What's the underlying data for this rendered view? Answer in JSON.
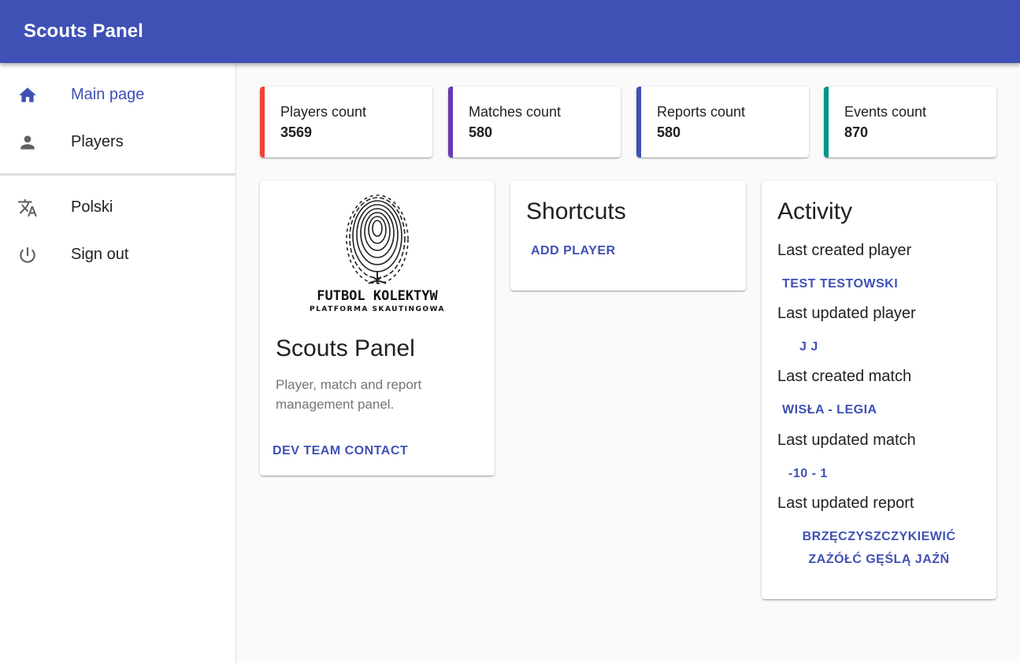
{
  "app": {
    "title": "Scouts Panel"
  },
  "nav": {
    "items": [
      {
        "label": "Main page",
        "icon": "home-icon"
      },
      {
        "label": "Players",
        "icon": "person-icon"
      }
    ],
    "secondary": [
      {
        "label": "Polski",
        "icon": "translate-icon"
      },
      {
        "label": "Sign out",
        "icon": "power-icon"
      }
    ]
  },
  "stats": [
    {
      "label": "Players count",
      "value": "3569",
      "color": "#f44336"
    },
    {
      "label": "Matches count",
      "value": "580",
      "color": "#673ab7"
    },
    {
      "label": "Reports count",
      "value": "580",
      "color": "#3f51b5"
    },
    {
      "label": "Events count",
      "value": "870",
      "color": "#009688"
    }
  ],
  "about": {
    "logo_text": "FUTBOL KOLEKTYW",
    "logo_subtext": "PLATFORMA SKAUTINGOWA",
    "title": "Scouts Panel",
    "description": "Player, match and report management panel.",
    "contact_label": "DEV TEAM CONTACT"
  },
  "shortcuts": {
    "title": "Shortcuts",
    "add_player_label": "ADD PLAYER"
  },
  "activity": {
    "title": "Activity",
    "last_created_player_label": "Last created player",
    "last_created_player": "TEST TESTOWSKI",
    "last_updated_player_label": "Last updated player",
    "last_updated_player": "J J",
    "last_created_match_label": "Last created match",
    "last_created_match": "WISŁA - LEGIA",
    "last_updated_match_label": "Last updated match",
    "last_updated_match": "-10 - 1",
    "last_updated_report_label": "Last updated report",
    "last_updated_report": "BRZĘCZYSZCZYKIEWIĆ ZAŻÓŁĆ GĘŚLĄ JAŹŃ"
  },
  "colors": {
    "primary": "#3f51b5",
    "icon": "#616161"
  }
}
